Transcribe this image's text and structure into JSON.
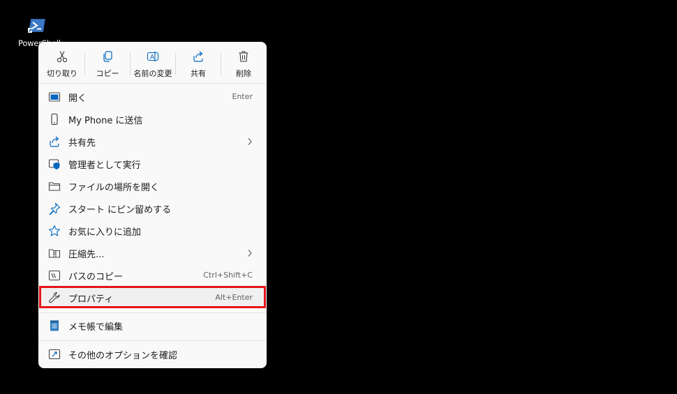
{
  "desktop": {
    "icon_label": "PowerShell"
  },
  "context_menu": {
    "toolbar": [
      {
        "label": "切り取り",
        "icon": "scissors-icon"
      },
      {
        "label": "コピー",
        "icon": "copy-icon"
      },
      {
        "label": "名前の変更",
        "icon": "rename-icon"
      },
      {
        "label": "共有",
        "icon": "share-icon"
      },
      {
        "label": "削除",
        "icon": "trash-icon"
      }
    ],
    "items": [
      {
        "label": "開く",
        "shortcut": "Enter",
        "icon": "open-window-icon"
      },
      {
        "label": "My Phone に送信",
        "shortcut": "",
        "icon": "phone-icon"
      },
      {
        "label": "共有先",
        "shortcut": "",
        "icon": "share-icon"
      },
      {
        "label": "管理者として実行",
        "shortcut": "",
        "icon": "admin-shield-icon"
      },
      {
        "label": "ファイルの場所を開く",
        "shortcut": "",
        "icon": "folder-icon"
      },
      {
        "label": "スタート にピン留めする",
        "shortcut": "",
        "icon": "pin-icon"
      },
      {
        "label": "お気に入りに追加",
        "shortcut": "",
        "icon": "star-icon"
      },
      {
        "label": "圧縮先...",
        "shortcut": "",
        "icon": "zip-folder-icon"
      },
      {
        "label": "パスのコピー",
        "shortcut": "Ctrl+Shift+C",
        "icon": "copy-path-icon"
      },
      {
        "label": "プロパティ",
        "shortcut": "Alt+Enter",
        "icon": "wrench-icon"
      },
      {
        "label": "メモ帳で編集",
        "shortcut": "",
        "icon": "notepad-icon"
      },
      {
        "label": "その他のオプションを確認",
        "shortcut": "",
        "icon": "more-options-icon"
      }
    ]
  },
  "colors": {
    "accent": "#0067c0",
    "highlight_border": "#e8141b",
    "menu_bg": "#f9f9f9"
  }
}
